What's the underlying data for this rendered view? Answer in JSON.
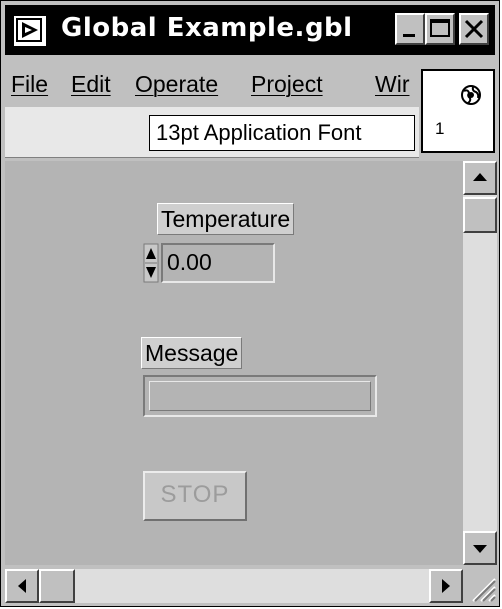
{
  "window": {
    "title": "Global Example.gbl"
  },
  "menubar": {
    "items": [
      "File",
      "Edit",
      "Operate",
      "Project",
      "Wir"
    ]
  },
  "toolbar": {
    "font_selector": "13pt Application Font"
  },
  "icon_pane": {
    "connector_number": "1"
  },
  "panel": {
    "temperature": {
      "label": "Temperature",
      "value": "0.00"
    },
    "message": {
      "label": "Message",
      "value": ""
    },
    "stop_button": {
      "label": "STOP"
    }
  },
  "icons": {
    "app_icon": "labview-run-icon",
    "minimize": "minimize-icon",
    "maximize": "maximize-icon",
    "close": "close-icon",
    "globe": "globe-icon",
    "scroll_up": "arrow-up-icon",
    "scroll_down": "arrow-down-icon",
    "scroll_left": "arrow-left-icon",
    "scroll_right": "arrow-right-icon"
  }
}
